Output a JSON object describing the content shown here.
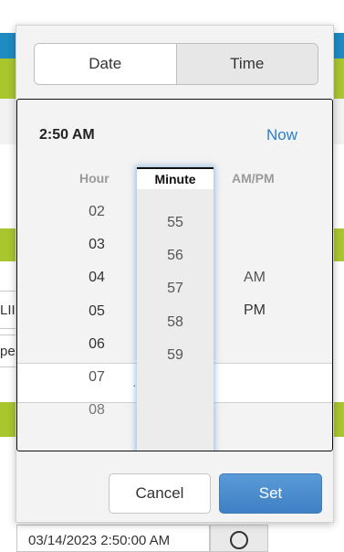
{
  "background": {
    "left_chip_text": "LII",
    "left_input_text": "per",
    "bottom_field_value": "03/14/2023 2:50:00 AM"
  },
  "tabs": {
    "date_label": "Date",
    "time_label": "Time",
    "active": "Time"
  },
  "picker": {
    "current_time": "2:50 AM",
    "now_label": "Now",
    "headers": {
      "hour": "Hour",
      "minute": "Minute",
      "ampm": "AM/PM"
    },
    "hours": [
      "02",
      "03",
      "04",
      "05",
      "06",
      "07",
      "08"
    ],
    "minutes": [
      "55",
      "56",
      "57",
      "58",
      "59"
    ],
    "ampm": [
      "AM",
      "PM"
    ],
    "selected": {
      "hour": "05",
      "ampm": "PM"
    }
  },
  "actions": {
    "cancel_label": "Cancel",
    "set_label": "Set"
  },
  "colors": {
    "accent": "#4a8fd1",
    "link": "#2a7fc7",
    "header_blue": "#1e8bc3",
    "header_green": "#a9c62f"
  }
}
